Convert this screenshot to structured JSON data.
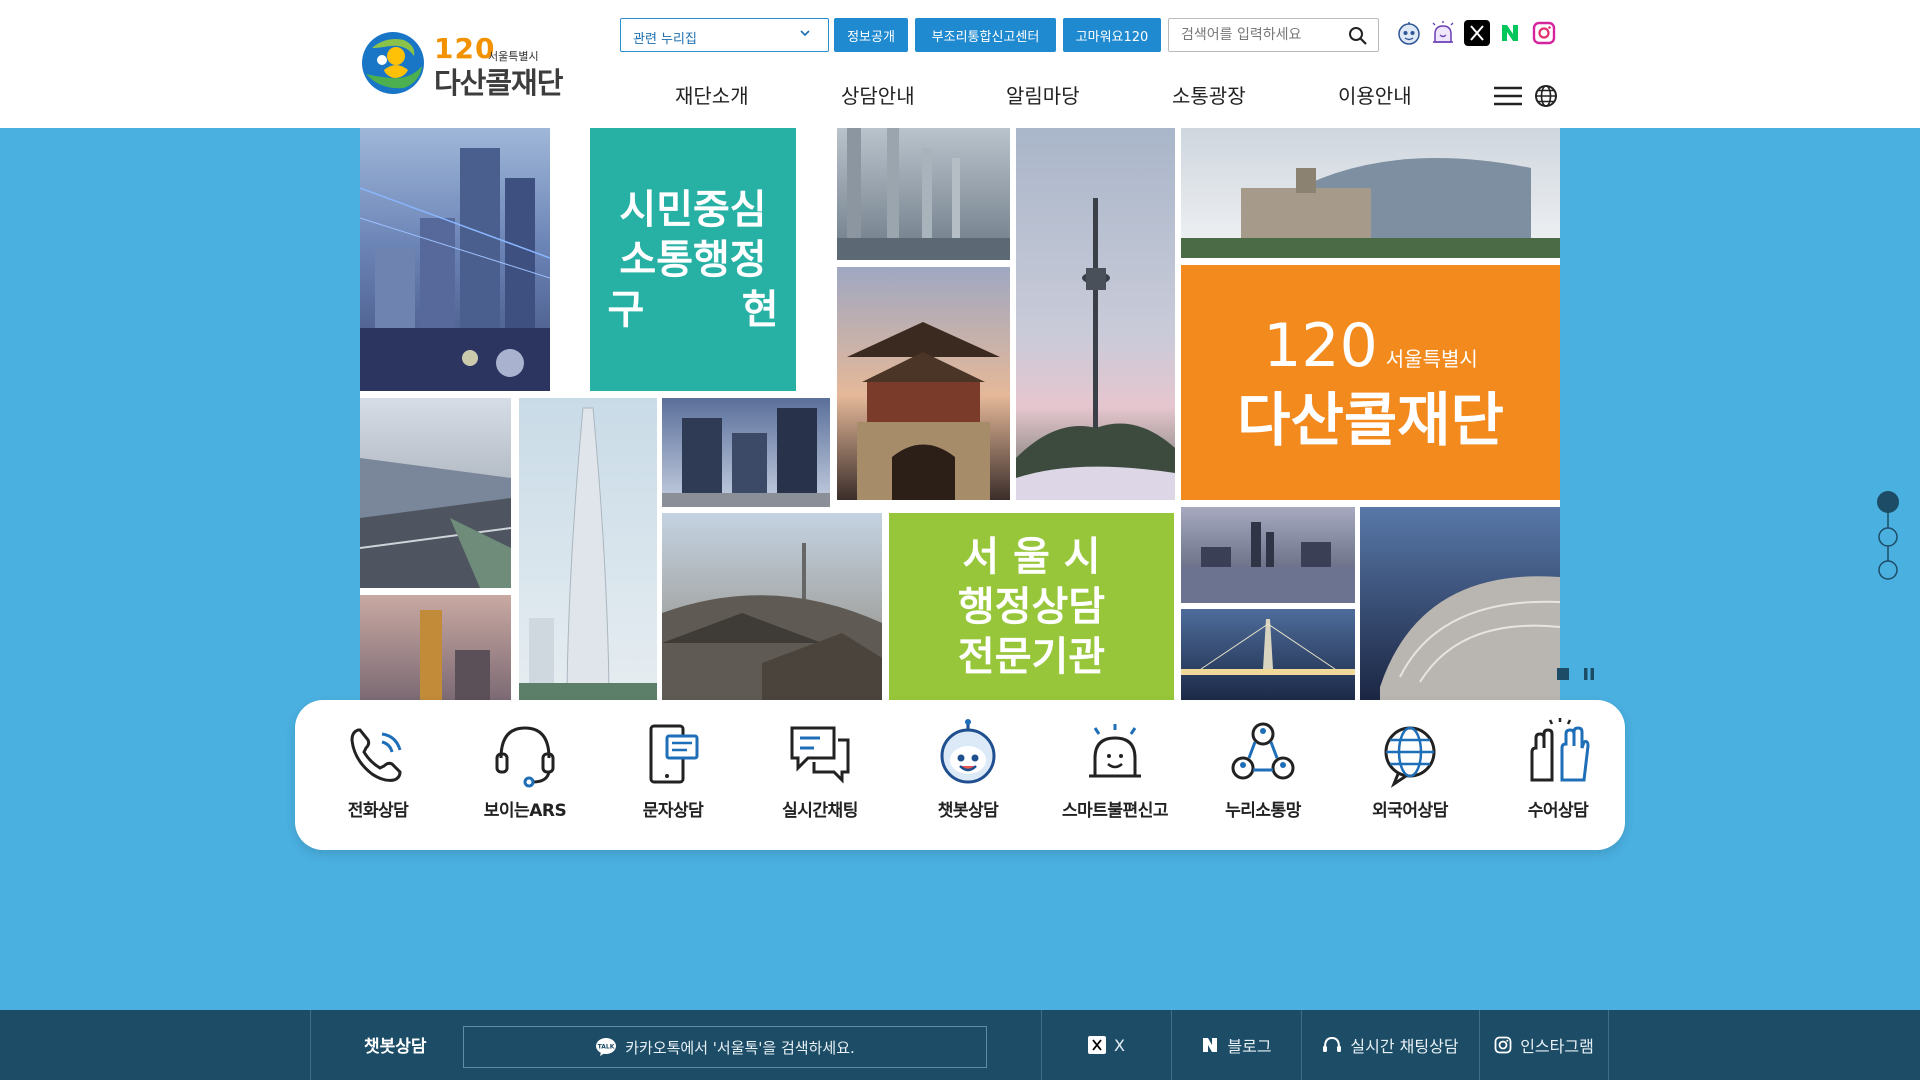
{
  "header": {
    "logo": {
      "number": "120",
      "sub": "서울특별시",
      "name": "다산콜재단"
    },
    "related_sites": {
      "label": "관련 누리집"
    },
    "top_buttons": [
      {
        "label": "정보공개"
      },
      {
        "label": "부조리통합신고센터"
      },
      {
        "label": "고마워요120"
      }
    ],
    "search": {
      "placeholder": "검색어를 입력하세요"
    },
    "sns_icons": [
      "chatbot-icon",
      "smart-report-icon",
      "x-icon",
      "naver-blog-icon",
      "instagram-icon"
    ],
    "nav": [
      {
        "label": "재단소개"
      },
      {
        "label": "상담안내"
      },
      {
        "label": "알림마당"
      },
      {
        "label": "소통광장"
      },
      {
        "label": "이용안내"
      }
    ]
  },
  "hero": {
    "tile_texts": {
      "citizen": [
        "시민중심",
        "소통행정",
        "구       현"
      ],
      "brand_number": "120",
      "brand_sub": "서울특별시",
      "brand_name": "다산콜재단",
      "seoul": [
        "서 울 시",
        "행정상담",
        "전문기관"
      ]
    }
  },
  "services": [
    {
      "label": "전화상담",
      "icon": "phone-icon"
    },
    {
      "label": "보이는ARS",
      "icon": "headset-icon"
    },
    {
      "label": "문자상담",
      "icon": "sms-icon"
    },
    {
      "label": "실시간채팅",
      "icon": "chat-icon"
    },
    {
      "label": "챗봇상담",
      "icon": "chatbot-icon"
    },
    {
      "label": "스마트불편신고",
      "icon": "alarm-icon"
    },
    {
      "label": "누리소통망",
      "icon": "network-icon"
    },
    {
      "label": "외국어상담",
      "icon": "globe-icon"
    },
    {
      "label": "수어상담",
      "icon": "sign-language-icon"
    }
  ],
  "footer_bar": {
    "chatbot_label": "챗봇상담",
    "kakao_text": "카카오톡에서 '서울톡'을 검색하세요.",
    "links": [
      {
        "label": "X"
      },
      {
        "label": "블로그"
      },
      {
        "label": "실시간 채팅상담"
      },
      {
        "label": "인스타그램"
      }
    ]
  },
  "colors": {
    "page_bg": "#4ab0e0",
    "primary_blue": "#1f8ad0",
    "footer_bg": "#1c4c66",
    "teal_tile": "#27b0a4",
    "orange_tile": "#f28a1e",
    "green_tile": "#97c63a"
  }
}
